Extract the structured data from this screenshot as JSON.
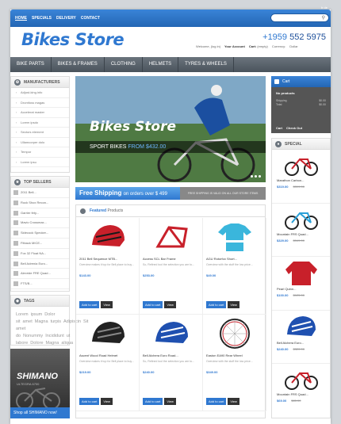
{
  "topnav": {
    "items": [
      "Home",
      "Specials",
      "Delivery",
      "Contact"
    ],
    "lang": "fr  de"
  },
  "brand": {
    "logo": "Bikes Store",
    "phone_prefix": "+1959",
    "phone_number": "552 5975"
  },
  "header_links": {
    "welcome": "Welcome, (log in)",
    "account": "Your Account",
    "cart": "Cart:",
    "cart_value": "(empty)",
    "currency_label": "Currency:",
    "currency": "Dollar"
  },
  "mainnav": [
    "Bike Parts",
    "Bikes & Frames",
    "Clothing",
    "Helmets",
    "Tyres & Wheels"
  ],
  "manufacturers": {
    "title": "Manufacturers",
    "items": [
      "Adjust-king.info",
      "Dromfoss magas",
      "Accelerat master",
      "Lorem ipsdo",
      "Sectors element",
      "Ullamcorper dolo",
      "Tempor",
      "Lorem ipsu"
    ]
  },
  "top_sellers": {
    "title": "Top Sellers",
    "items": [
      "2011 Bell...",
      "Rock Shox Recon...",
      "Garrier fety...",
      "Mavic Crossmax...",
      "Sidecock Specker...",
      "Fitback MICE...",
      "Fox 32 Float NA...",
      "Bell Adrenia Euro...",
      "Alexride FRE Quad...",
      "FTS/B..."
    ]
  },
  "tags": {
    "title": "Tags",
    "items": [
      "Lorem",
      "ipsum",
      "Dolor sit",
      "amet",
      "Magna",
      "turpis",
      "Adipiscin",
      "Sit amet do",
      "Nonummy",
      "Incididunt",
      "ut labore",
      "Dolore",
      "Magna",
      "aliqua"
    ]
  },
  "shimano": {
    "brand": "SHIMANO",
    "sub": "ULTEGRA 6700",
    "button": "Shop all SHIMANO now!"
  },
  "slider": {
    "title": "Bikes Store",
    "caption": "SPORT BIKES",
    "price": "FROM $432.00"
  },
  "shipping": {
    "bold": "Free Shipping",
    "text": "on orders over $ 499",
    "note": "FREE SHIPPING IS VALID ON ALL OUR STORE ITEMS"
  },
  "featured": {
    "title_bold": "Featured",
    "title_rest": "Products",
    "add_label": "Add to cart",
    "view_label": "View",
    "products": [
      {
        "name": "2011 Bell Sequence MTB...",
        "desc": "Overview makes it top for Bell place to buy...",
        "price": "$143.00",
        "icon": "helmet-red"
      },
      {
        "name": "Access SCL Bar Frame",
        "desc": "So, Refined tool the selection you are to...",
        "price": "$253.00",
        "icon": "frame-red"
      },
      {
        "name": "AGU Rotorfox Short...",
        "desc": "Overview with the stuff the low price...",
        "price": "$49.00",
        "icon": "jersey-cyan"
      },
      {
        "name": "Ascent Wood Road Helmet",
        "desc": "Overview makes it top for Bell place to buy...",
        "price": "$219.00",
        "icon": "helmet-black"
      },
      {
        "name": "Bell Alchera Euro Road...",
        "desc": "So, Refined tool the selection you are to...",
        "price": "$240.00",
        "icon": "helmet-blue"
      },
      {
        "name": "Easton EA90 Rear Wheel",
        "desc": "Overview with the stuff the low price...",
        "price": "$349.00",
        "icon": "wheel"
      }
    ]
  },
  "cart": {
    "title": "Cart",
    "status": "No products",
    "shipping_label": "Shipping",
    "shipping_value": "$0.00",
    "total_label": "Total",
    "total_value": "$0.00",
    "link_cart": "Cart",
    "link_checkout": "Check Out"
  },
  "special": {
    "title": "Special",
    "items": [
      {
        "name": "Marathon Carbon...",
        "price": "$319.00",
        "old": "$399.00",
        "icon": "bike-red"
      },
      {
        "name": "Mountain FRS Quad...",
        "price": "$329.00",
        "old": "$349.00",
        "icon": "bike-blue"
      },
      {
        "name": "Pearl Quinn...",
        "price": "$100.00",
        "old": "$125.00",
        "icon": "jacket-red"
      },
      {
        "name": "Bell Alchera Euro...",
        "price": "$240.00",
        "old": "$320.00",
        "icon": "helmet-blue"
      },
      {
        "name": "Mountain FRS Quad...",
        "price": "$69.00",
        "old": "$85.00",
        "icon": "bike-red"
      }
    ]
  },
  "colors": {
    "accent": "#2f78d0",
    "nav": "#555d66",
    "sidebar_bg": "#ffffff"
  }
}
